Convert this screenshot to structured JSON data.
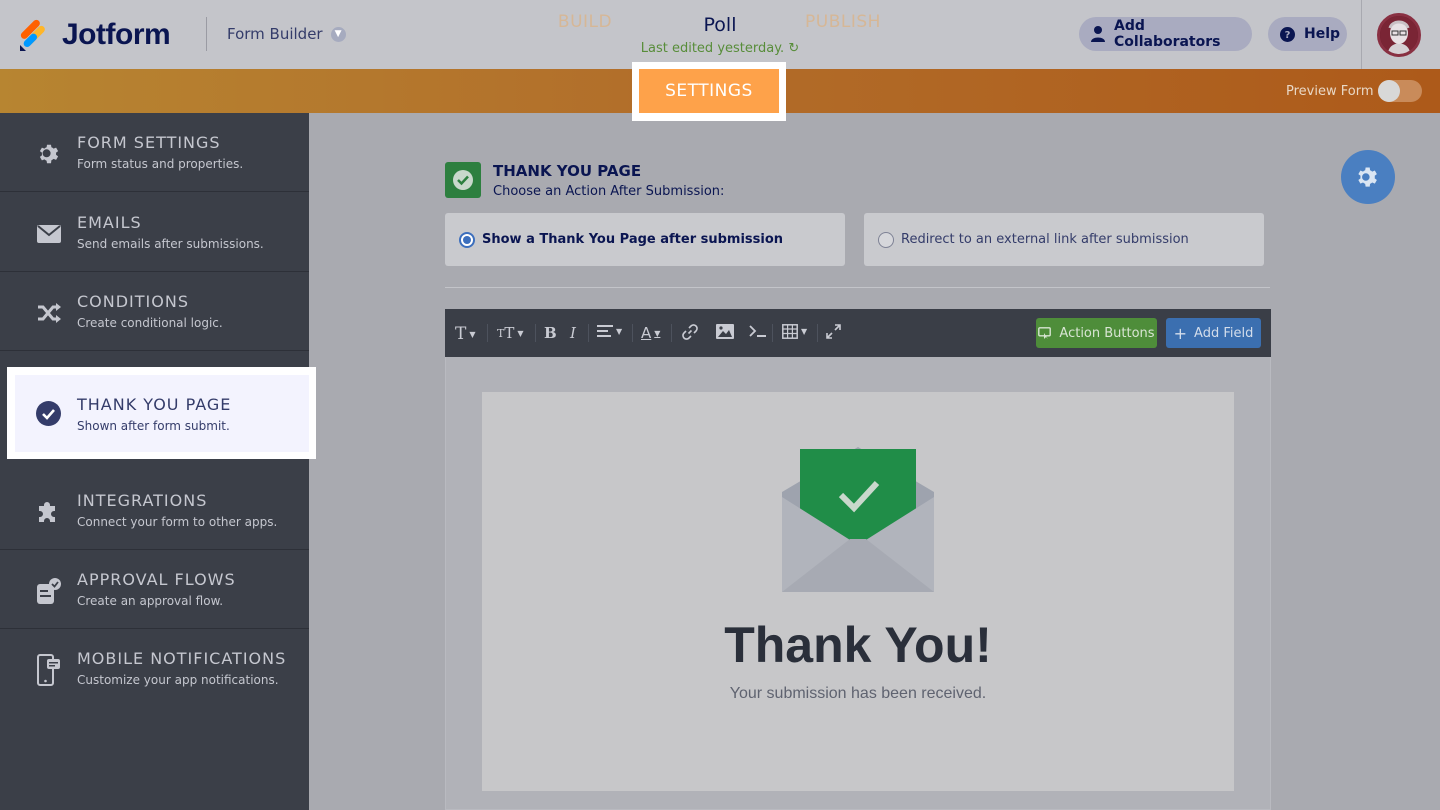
{
  "header": {
    "logo_text": "Jotform",
    "builder_label": "Form Builder",
    "form_title": "Poll",
    "last_edited": "Last edited yesterday.",
    "add_collaborators": "Add Collaborators",
    "help": "Help"
  },
  "nav": {
    "tabs": [
      "BUILD",
      "SETTINGS",
      "PUBLISH"
    ],
    "active_tab": "SETTINGS",
    "preview_label": "Preview Form",
    "preview_enabled": false
  },
  "sidebar": {
    "items": [
      {
        "title": "FORM SETTINGS",
        "desc": "Form status and properties.",
        "icon": "gear-icon"
      },
      {
        "title": "EMAILS",
        "desc": "Send emails after submissions.",
        "icon": "envelope-icon"
      },
      {
        "title": "CONDITIONS",
        "desc": "Create conditional logic.",
        "icon": "shuffle-icon"
      },
      {
        "title": "THANK YOU PAGE",
        "desc": "Shown after form submit.",
        "icon": "check-circle-icon"
      },
      {
        "title": "INTEGRATIONS",
        "desc": "Connect your form to other apps.",
        "icon": "puzzle-icon"
      },
      {
        "title": "APPROVAL FLOWS",
        "desc": "Create an approval flow.",
        "icon": "approval-icon"
      },
      {
        "title": "MOBILE NOTIFICATIONS",
        "desc": "Customize your app notifications.",
        "icon": "mobile-icon"
      }
    ],
    "active_index": 3
  },
  "main": {
    "section_title": "THANK YOU PAGE",
    "section_subtitle": "Choose an Action After Submission:",
    "options": [
      {
        "label": "Show a Thank You Page after submission",
        "selected": true
      },
      {
        "label": "Redirect to an external link after submission",
        "selected": false
      }
    ],
    "toolbar": {
      "action_buttons": "Action Buttons",
      "add_field": "Add Field"
    },
    "preview": {
      "heading": "Thank You!",
      "message": "Your submission has been received."
    }
  },
  "colors": {
    "nav_orange": "#b26e2a",
    "active_tab": "#fea24a",
    "sidebar_bg": "#3b3f48",
    "action_green": "#4e8d3a",
    "field_blue": "#3b6fb0"
  }
}
